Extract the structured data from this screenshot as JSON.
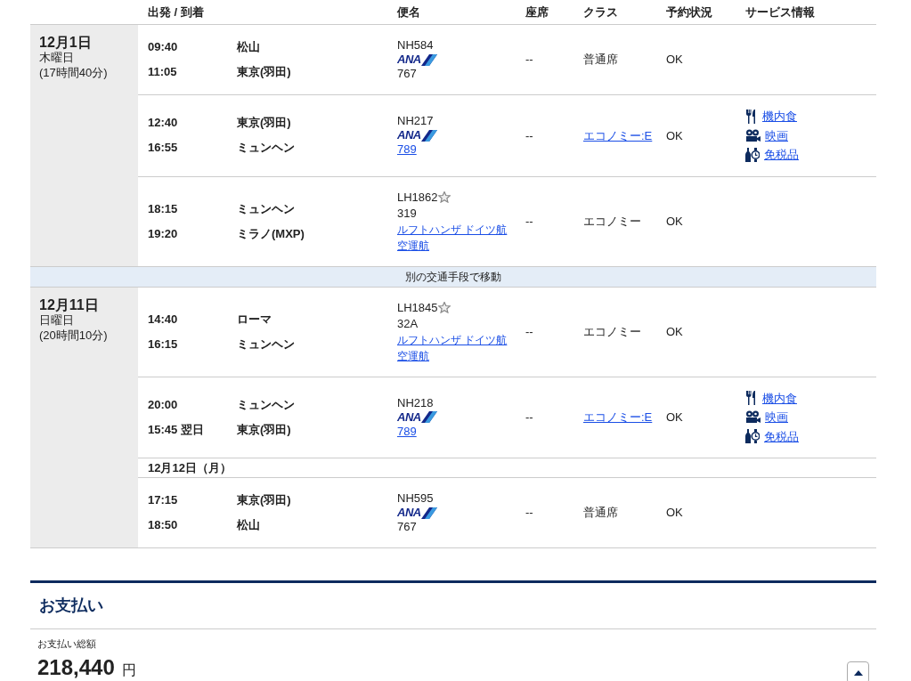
{
  "header": {
    "columns": [
      "出発 / 到着",
      "便名",
      "座席",
      "クラス",
      "予約状況",
      "サービス情報"
    ]
  },
  "itinerary": [
    {
      "kind": "day",
      "date": "12月1日",
      "weekday": "木曜日",
      "duration": "(17時間40分)",
      "segments": [
        {
          "kind": "flight",
          "dep_time": "09:40",
          "dep_city": "松山",
          "arr_time": "11:05",
          "arr_city": "東京(羽田)",
          "flight_no": "NH584",
          "star": false,
          "logo": "ANA",
          "aircraft": "767",
          "aircraft_link": false,
          "seat": "--",
          "class": "普通席",
          "class_link": false,
          "status": "OK"
        },
        {
          "kind": "flight",
          "dep_time": "12:40",
          "dep_city": "東京(羽田)",
          "arr_time": "16:55",
          "arr_city": "ミュンヘン",
          "flight_no": "NH217",
          "star": false,
          "logo": "ANA",
          "aircraft": "789",
          "aircraft_link": true,
          "seat": "--",
          "class": "エコノミー:E",
          "class_link": true,
          "status": "OK",
          "services": [
            {
              "kind": "meal",
              "label": "機内食"
            },
            {
              "kind": "movie",
              "label": "映画"
            },
            {
              "kind": "dutyfree",
              "label": "免税品"
            }
          ]
        },
        {
          "kind": "flight",
          "dep_time": "18:15",
          "dep_city": "ミュンヘン",
          "arr_time": "19:20",
          "arr_city": "ミラノ(MXP)",
          "flight_no": "LH1862",
          "star": true,
          "aircraft": "319",
          "aircraft_link": false,
          "operator": "ルフトハンザ ドイツ航空運航",
          "seat": "--",
          "class": "エコノミー",
          "class_link": false,
          "status": "OK"
        }
      ]
    },
    {
      "kind": "transfer",
      "text": "別の交通手段で移動"
    },
    {
      "kind": "day",
      "date": "12月11日",
      "weekday": "日曜日",
      "duration": "(20時間10分)",
      "segments": [
        {
          "kind": "flight",
          "dep_time": "14:40",
          "dep_city": "ローマ",
          "arr_time": "16:15",
          "arr_city": "ミュンヘン",
          "flight_no": "LH1845",
          "star": true,
          "aircraft": "32A",
          "aircraft_link": false,
          "operator": "ルフトハンザ ドイツ航空運航",
          "seat": "--",
          "class": "エコノミー",
          "class_link": false,
          "status": "OK"
        },
        {
          "kind": "flight",
          "dep_time": "20:00",
          "dep_city": "ミュンヘン",
          "arr_time": "15:45",
          "arr_note": "翌日",
          "arr_city": "東京(羽田)",
          "flight_no": "NH218",
          "star": false,
          "logo": "ANA",
          "aircraft": "789",
          "aircraft_link": true,
          "seat": "--",
          "class": "エコノミー:E",
          "class_link": true,
          "status": "OK",
          "services": [
            {
              "kind": "meal",
              "label": "機内食"
            },
            {
              "kind": "movie",
              "label": "映画"
            },
            {
              "kind": "dutyfree",
              "label": "免税品"
            }
          ]
        },
        {
          "kind": "date_note",
          "text": "12月12日（月）"
        },
        {
          "kind": "flight",
          "dep_time": "17:15",
          "dep_city": "東京(羽田)",
          "arr_time": "18:50",
          "arr_city": "松山",
          "flight_no": "NH595",
          "star": false,
          "logo": "ANA",
          "aircraft": "767",
          "aircraft_link": false,
          "seat": "--",
          "class": "普通席",
          "class_link": false,
          "status": "OK"
        }
      ]
    }
  ],
  "payment": {
    "title": "お支払い",
    "total_label": "お支払い総額",
    "amount": "218,440",
    "currency": "円"
  }
}
